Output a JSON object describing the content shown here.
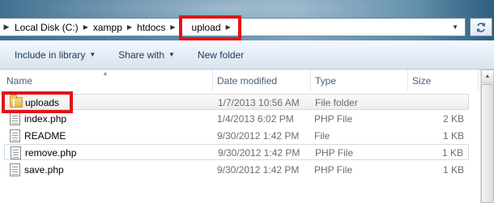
{
  "address_bar": {
    "crumbs": [
      "Local Disk (C:)",
      "xampp",
      "htdocs",
      "upload"
    ]
  },
  "toolbar": {
    "include_label": "Include in library",
    "share_label": "Share with",
    "new_folder_label": "New folder"
  },
  "columns": {
    "name": "Name",
    "date": "Date modified",
    "type": "Type",
    "size": "Size"
  },
  "files": [
    {
      "name": "uploads",
      "date": "1/7/2013 10:56 AM",
      "type": "File folder",
      "size": "",
      "icon": "folder-icon"
    },
    {
      "name": "index.php",
      "date": "1/4/2013 6:02 PM",
      "type": "PHP File",
      "size": "2 KB",
      "icon": "php-file-icon"
    },
    {
      "name": "README",
      "date": "9/30/2012 1:42 PM",
      "type": "File",
      "size": "1 KB",
      "icon": "file-icon"
    },
    {
      "name": "remove.php",
      "date": "9/30/2012 1:42 PM",
      "type": "PHP File",
      "size": "1 KB",
      "icon": "php-file-icon"
    },
    {
      "name": "save.php",
      "date": "9/30/2012 1:42 PM",
      "type": "PHP File",
      "size": "1 KB",
      "icon": "php-file-icon"
    }
  ],
  "colors": {
    "highlight_box": "#e0141a",
    "toolbar_text": "#1e395b"
  }
}
